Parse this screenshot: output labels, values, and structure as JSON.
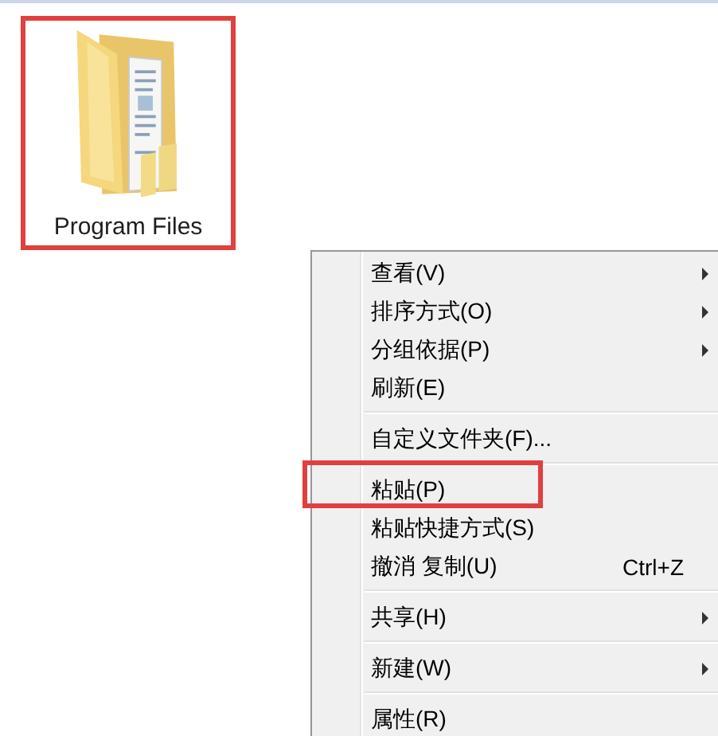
{
  "desktop_icon": {
    "label": "Program Files",
    "annotated": true
  },
  "context_menu": {
    "items": [
      {
        "kind": "item",
        "label": "查看(V)",
        "submenu": true,
        "annotated": false
      },
      {
        "kind": "item",
        "label": "排序方式(O)",
        "submenu": true,
        "annotated": false
      },
      {
        "kind": "item",
        "label": "分组依据(P)",
        "submenu": true,
        "annotated": false
      },
      {
        "kind": "item",
        "label": "刷新(E)",
        "submenu": false,
        "annotated": false
      },
      {
        "kind": "separator"
      },
      {
        "kind": "item",
        "label": "自定义文件夹(F)...",
        "submenu": false,
        "annotated": false
      },
      {
        "kind": "separator"
      },
      {
        "kind": "item",
        "label": "粘贴(P)",
        "submenu": false,
        "annotated": true
      },
      {
        "kind": "item",
        "label": "粘贴快捷方式(S)",
        "submenu": false,
        "annotated": false
      },
      {
        "kind": "item",
        "label": "撤消 复制(U)",
        "shortcut": "Ctrl+Z",
        "submenu": false,
        "annotated": false
      },
      {
        "kind": "separator"
      },
      {
        "kind": "item",
        "label": "共享(H)",
        "submenu": true,
        "annotated": false
      },
      {
        "kind": "separator"
      },
      {
        "kind": "item",
        "label": "新建(W)",
        "submenu": true,
        "annotated": false
      },
      {
        "kind": "separator"
      },
      {
        "kind": "item",
        "label": "属性(R)",
        "submenu": false,
        "annotated": false
      }
    ]
  }
}
